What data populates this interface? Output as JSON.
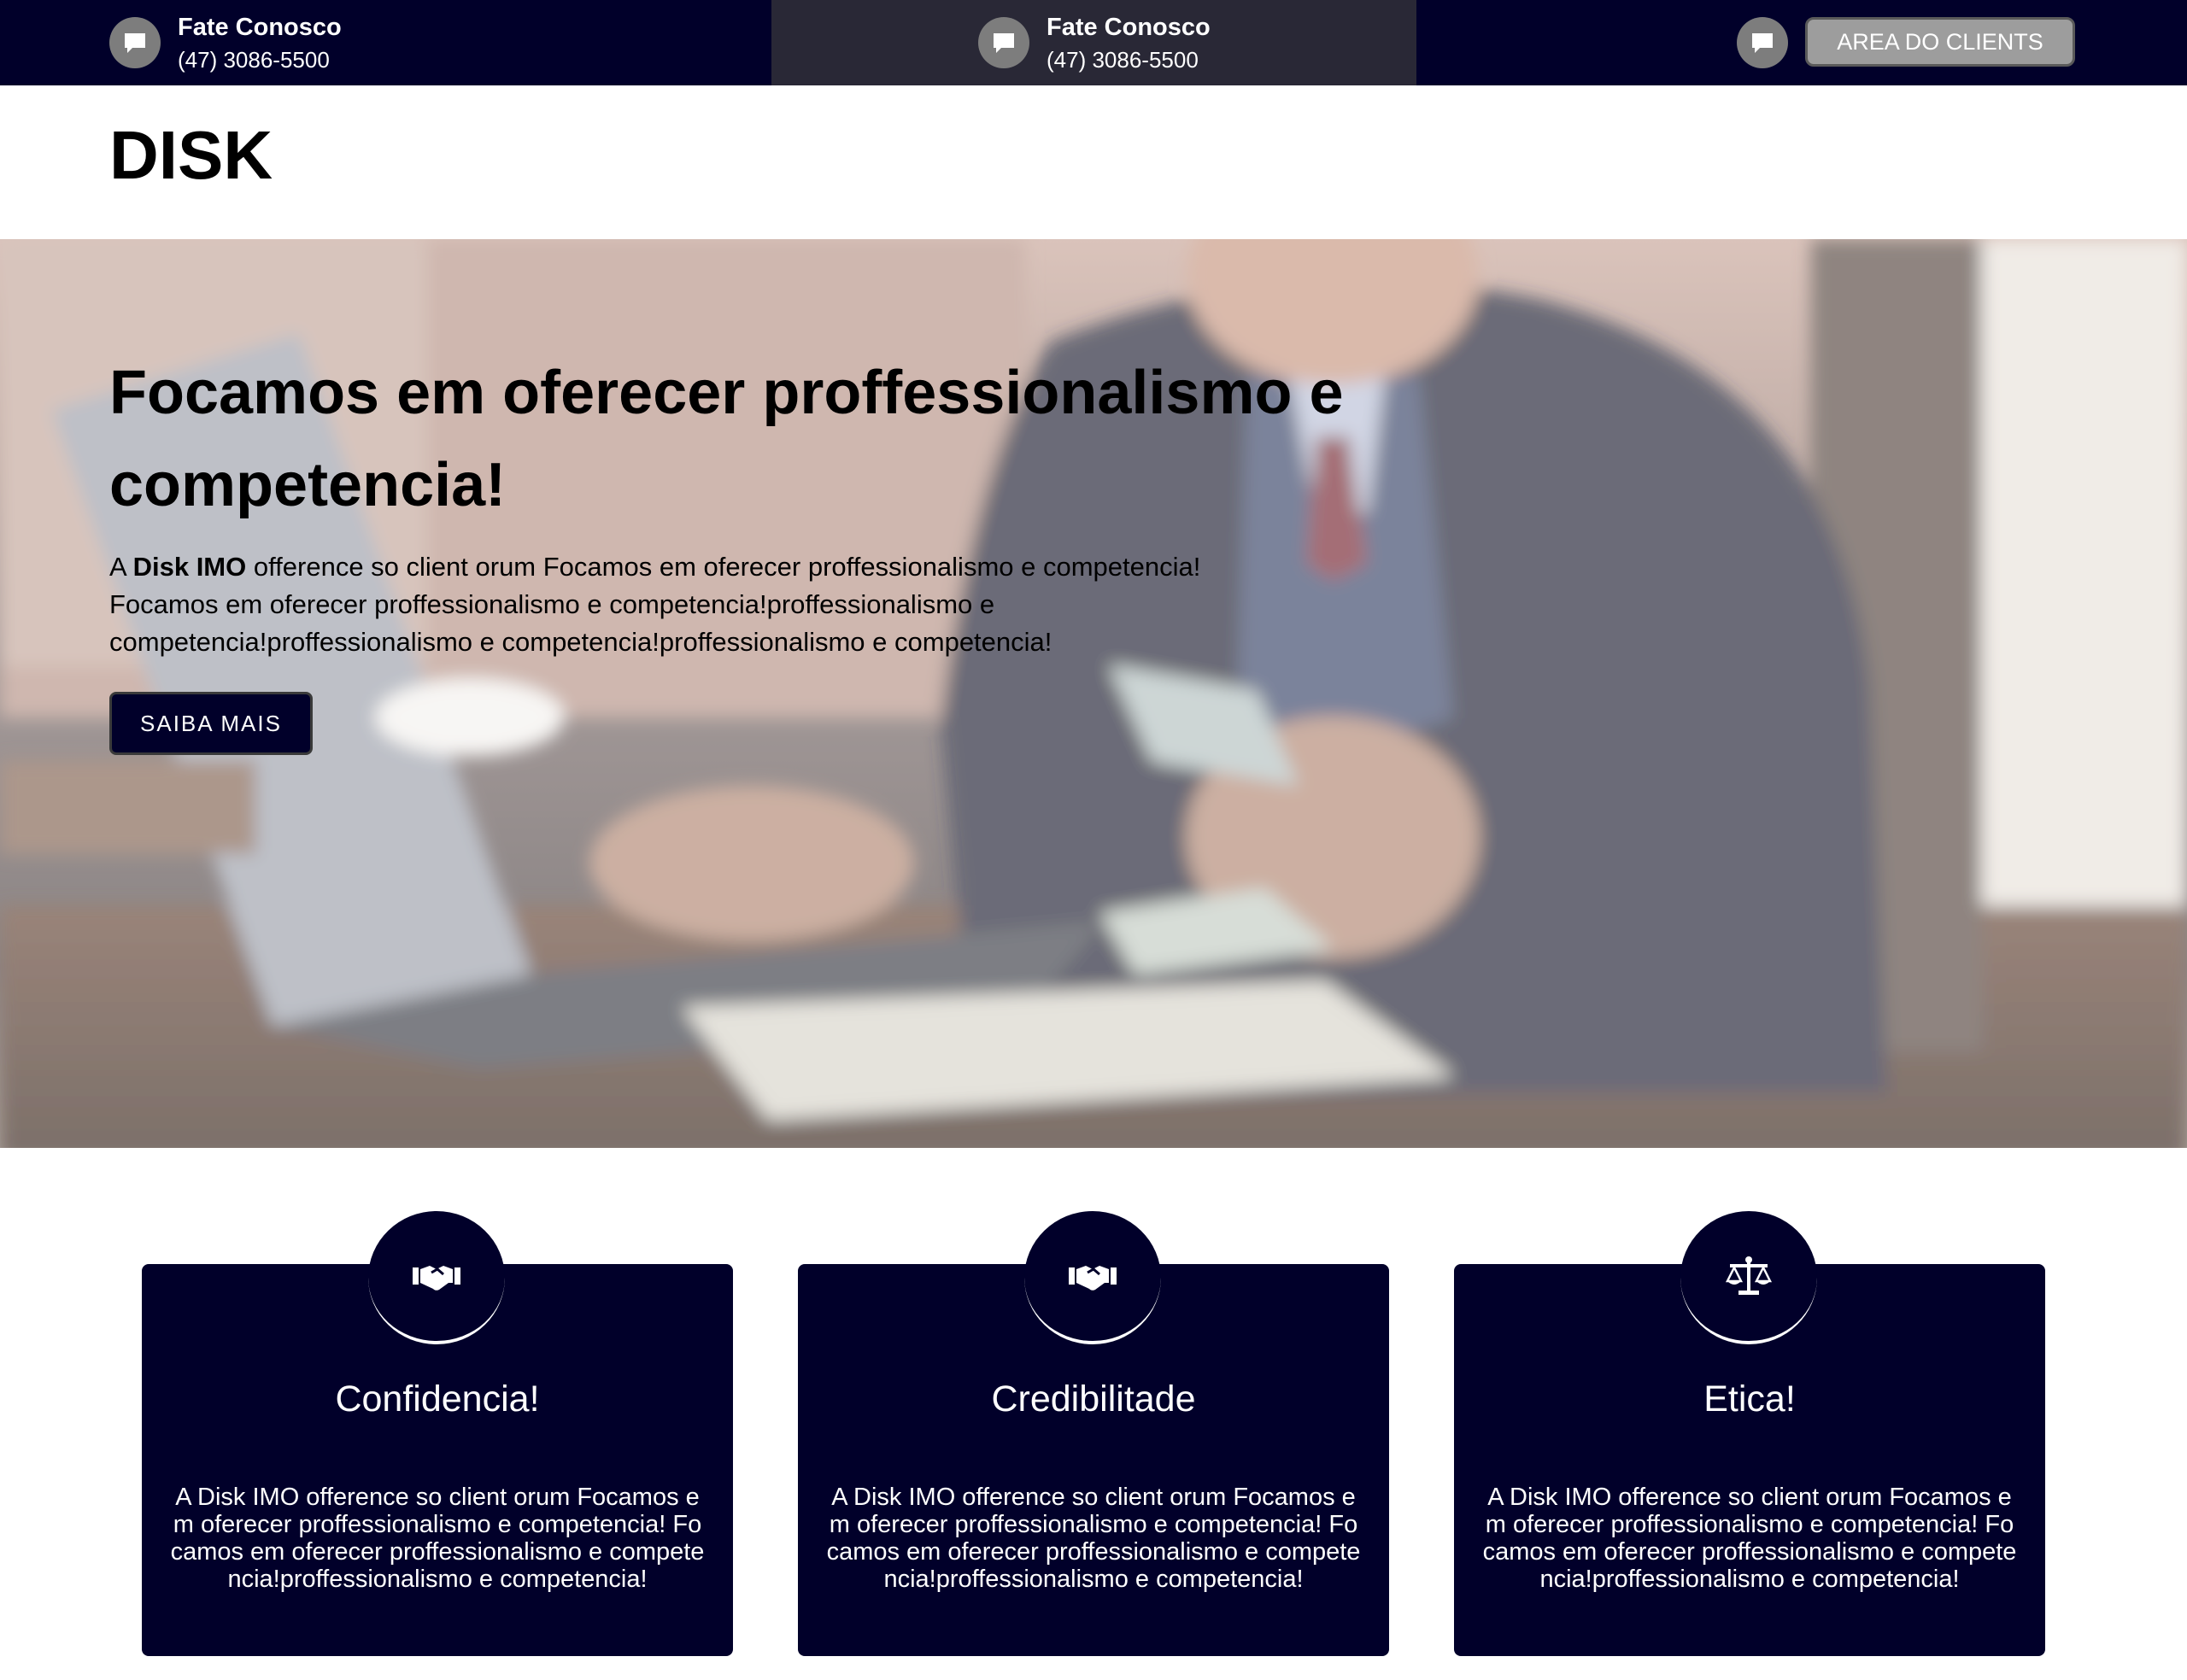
{
  "topbar": {
    "contact_1": {
      "title": "Fate Conosco",
      "phone": "(47) 3086-5500",
      "icon": "chat-bubble-icon"
    },
    "contact_2": {
      "title": "Fate Conosco",
      "phone": "(47) 3086-5500",
      "icon": "chat-bubble-icon"
    },
    "contact_3": {
      "icon": "chat-bubble-icon"
    },
    "client_button_label": "AREA DO CLIENTS"
  },
  "header": {
    "logo": "DISK"
  },
  "hero": {
    "title": "Focamos em oferecer proffessionalismo e competencia!",
    "text_prefix": "A ",
    "text_brand": "Disk IMO",
    "text_body": " ofference so client orum Focamos em oferecer proffessionalismo e competencia! Focamos em oferecer proffessionalismo e competencia!proffessionalismo e competencia!proffessionalismo e competencia!proffessionalismo e competencia!",
    "button_label": "SAIBA MAIS"
  },
  "features": [
    {
      "icon": "handshake-icon",
      "title": "Confidencia!",
      "text": "A Disk IMO ofference so client orum Focamos em oferecer proffessionalismo e competencia! Focamos em oferecer proffessionalismo e competencia!proffessionalismo e competencia!"
    },
    {
      "icon": "handshake-icon",
      "title": "Credibilitade",
      "text": "A Disk IMO ofference so client orum Focamos em oferecer proffessionalismo e competencia! Focamos em oferecer proffessionalismo e competencia!proffessionalismo e competencia!"
    },
    {
      "icon": "scales-icon",
      "title": "Etica!",
      "text": "A Disk IMO ofference so client orum Focamos em oferecer proffessionalismo e competencia! Focamos em oferecer proffessionalismo e competencia!proffessionalismo e competencia!"
    }
  ],
  "colors": {
    "navy": "#01002a",
    "topbar_middle": "#292836",
    "icon_grey": "#7d7d7d",
    "client_button": "#9d9d9d"
  }
}
